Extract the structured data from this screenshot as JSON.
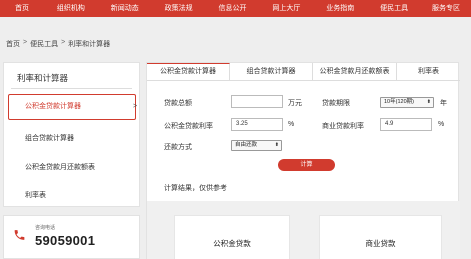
{
  "nav": {
    "items": [
      "首页",
      "组织机构",
      "新闻动态",
      "政策法规",
      "信息公开",
      "网上大厅",
      "业务指南",
      "便民工具",
      "服务专区"
    ],
    "bg_color": "#d13b2e"
  },
  "breadcrumb": {
    "items": [
      "首页",
      "便民工具",
      "利率和计算器"
    ],
    "separator": ">"
  },
  "sidebar": {
    "title": "利率和计算器",
    "items": [
      "公积金贷款计算器",
      "组合贷款计算器",
      "公积金贷款月还款额表",
      "利率表"
    ],
    "active_chevron": ">"
  },
  "hotline": {
    "label": "咨询电话",
    "number": "59059001",
    "icon": "phone-icon"
  },
  "tabs": [
    "公积金贷款计算器",
    "组合贷款计算器",
    "公积金贷款月还款额表",
    "利率表"
  ],
  "form": {
    "loan_total_label": "贷款总额",
    "loan_total_value": "",
    "loan_total_unit": "万元",
    "loan_term_label": "贷款期限",
    "loan_term_value": "10年(120期)",
    "loan_term_unit": "年",
    "hpf_rate_label": "公积金贷款利率",
    "hpf_rate_value": "3.25",
    "hpf_rate_unit": "%",
    "commercial_rate_label": "商业贷款利率",
    "commercial_rate_value": "4.9",
    "commercial_rate_unit": "%",
    "repay_method_label": "还款方式",
    "repay_method_value": "自由还款",
    "calc_button": "计算",
    "result_note": "计算结果，仅供参考"
  },
  "results": {
    "hpf_title": "公积金贷款",
    "commercial_title": "商业贷款"
  },
  "colors": {
    "accent": "#d13b2e"
  }
}
